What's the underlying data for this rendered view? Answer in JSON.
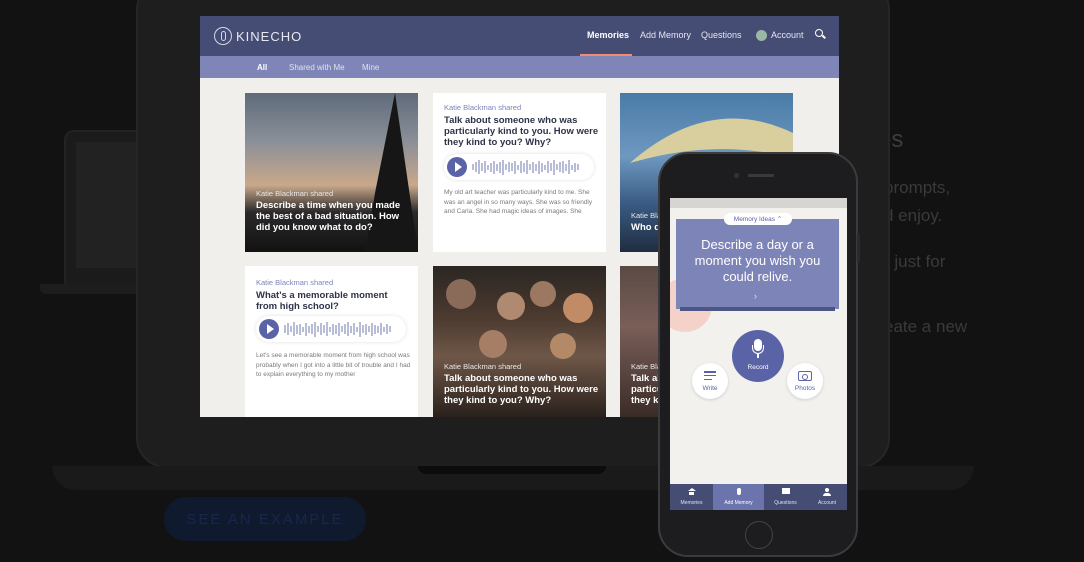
{
  "background": {
    "lines": [
      "es",
      "prompts,",
      "d enjoy.",
      "r just for",
      "eate a new"
    ],
    "cta_label": "SEE AN EXAMPLE"
  },
  "app": {
    "logo_text": "KINECHO",
    "nav": {
      "memories": "Memories",
      "add_memory": "Add Memory",
      "questions": "Questions",
      "account": "Account"
    },
    "subnav": {
      "all": "All",
      "shared": "Shared with Me",
      "mine": "Mine"
    },
    "cards": [
      {
        "shared": "Katie Blackman shared",
        "prompt": "Describe a time when you made the best of a bad situation. How did you know what to do?"
      },
      {
        "shared": "Katie Blackman shared",
        "prompt": "Talk about someone who was particularly kind to you. How were they kind to you? Why?",
        "body": "My old art teacher was particularly kind to me. She was an angel in so many ways. She was so friendly and Carla. She had magic ideas of images. She"
      },
      {
        "shared": "Katie Blackman shared",
        "prompt": "Who do"
      },
      {
        "shared": "Katie Blackman shared",
        "prompt": "What's a memorable moment from high school?",
        "body": "Let's see a memorable moment from high school was probably when I got into a little bit of trouble and I had to explain everything to my mother"
      },
      {
        "shared": "Katie Blackman shared",
        "prompt": "Talk about someone who was particularly kind to you. How were they kind to you? Why?"
      },
      {
        "shared": "Katie Blackman shared",
        "prompt": "Talk ab particularly they ki"
      }
    ]
  },
  "phone": {
    "memory_ideas": "Memory Ideas ⌃",
    "prompt": "Describe a day or a moment you wish you could relive.",
    "chevron": "›",
    "record": "Record",
    "write": "Write",
    "photos": "Photos",
    "tabs": {
      "memories": "Memories",
      "add_memory": "Add Memory",
      "questions": "Questions",
      "account": "Account"
    }
  }
}
